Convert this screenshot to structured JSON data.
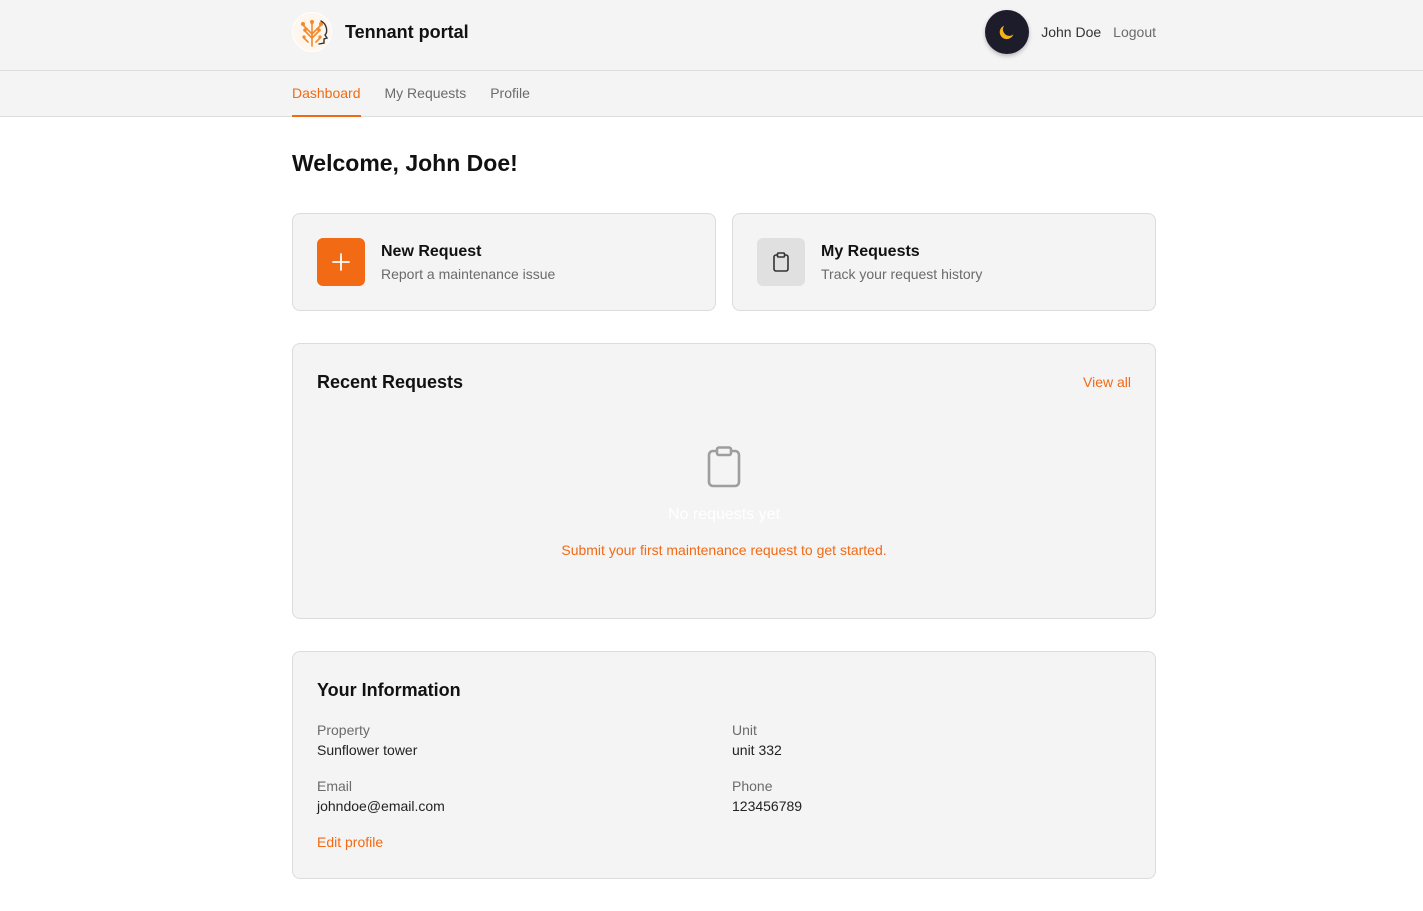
{
  "app": {
    "title": "Tennant portal"
  },
  "user": {
    "name": "John Doe",
    "logout_label": "Logout"
  },
  "nav": {
    "tabs": [
      "Dashboard",
      "My Requests",
      "Profile"
    ],
    "active": "Dashboard"
  },
  "welcome": "Welcome, John Doe!",
  "actions": [
    {
      "title": "New Request",
      "description": "Report a maintenance issue",
      "icon": "plus-icon"
    },
    {
      "title": "My Requests",
      "description": "Track your request history",
      "icon": "clipboard-icon"
    }
  ],
  "recent": {
    "title": "Recent Requests",
    "view_all_label": "View all",
    "empty_title": "No requests yet",
    "empty_description": "Submit your first maintenance request to get started.",
    "empty_icon": "clipboard-icon"
  },
  "info": {
    "title": "Your Information",
    "fields": [
      {
        "label": "Property",
        "value": "Sunflower tower"
      },
      {
        "label": "Unit",
        "value": "unit 332"
      },
      {
        "label": "Email",
        "value": "johndoe@email.com"
      },
      {
        "label": "Phone",
        "value": "123456789"
      }
    ],
    "edit_label": "Edit profile"
  },
  "theme": {
    "toggle_icon": "moon-icon",
    "accent": "#f26a13",
    "panel_bg": "#f4f4f4"
  }
}
